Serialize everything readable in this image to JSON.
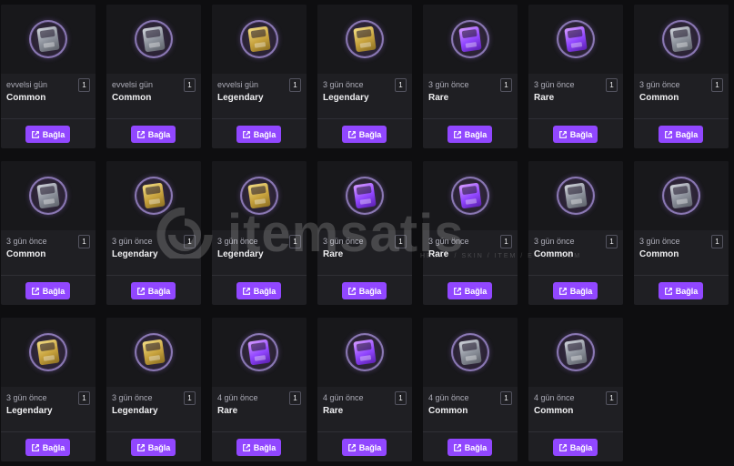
{
  "action_label": "Bağla",
  "watermark": {
    "text": "itemsatis",
    "subtitle": "HESAP / SKIN / ITEM / E-PIN .COM"
  },
  "rarity_colors": {
    "Common": "#9aa0a8",
    "Legendary": "#d4b04a",
    "Rare": "#9146ff"
  },
  "cards": [
    {
      "time": "evvelsi gün",
      "rarity": "Common",
      "chest": "common",
      "qty": "1"
    },
    {
      "time": "evvelsi gün",
      "rarity": "Common",
      "chest": "common",
      "qty": "1"
    },
    {
      "time": "evvelsi gün",
      "rarity": "Legendary",
      "chest": "legendary",
      "qty": "1"
    },
    {
      "time": "3 gün önce",
      "rarity": "Legendary",
      "chest": "legendary",
      "qty": "1"
    },
    {
      "time": "3 gün önce",
      "rarity": "Rare",
      "chest": "rare",
      "qty": "1"
    },
    {
      "time": "3 gün önce",
      "rarity": "Rare",
      "chest": "rare",
      "qty": "1"
    },
    {
      "time": "3 gün önce",
      "rarity": "Common",
      "chest": "common",
      "qty": "1"
    },
    {
      "time": "3 gün önce",
      "rarity": "Common",
      "chest": "common",
      "qty": "1"
    },
    {
      "time": "3 gün önce",
      "rarity": "Legendary",
      "chest": "legendary",
      "qty": "1"
    },
    {
      "time": "3 gün önce",
      "rarity": "Legendary",
      "chest": "legendary",
      "qty": "1"
    },
    {
      "time": "3 gün önce",
      "rarity": "Rare",
      "chest": "rare",
      "qty": "1"
    },
    {
      "time": "3 gün önce",
      "rarity": "Rare",
      "chest": "rare",
      "qty": "1"
    },
    {
      "time": "3 gün önce",
      "rarity": "Common",
      "chest": "common",
      "qty": "1"
    },
    {
      "time": "3 gün önce",
      "rarity": "Common",
      "chest": "common",
      "qty": "1"
    },
    {
      "time": "3 gün önce",
      "rarity": "Legendary",
      "chest": "legendary",
      "qty": "1"
    },
    {
      "time": "3 gün önce",
      "rarity": "Legendary",
      "chest": "legendary",
      "qty": "1"
    },
    {
      "time": "4 gün önce",
      "rarity": "Rare",
      "chest": "rare",
      "qty": "1"
    },
    {
      "time": "4 gün önce",
      "rarity": "Rare",
      "chest": "rare",
      "qty": "1"
    },
    {
      "time": "4 gün önce",
      "rarity": "Common",
      "chest": "common",
      "qty": "1"
    },
    {
      "time": "4 gün önce",
      "rarity": "Common",
      "chest": "common",
      "qty": "1"
    }
  ]
}
